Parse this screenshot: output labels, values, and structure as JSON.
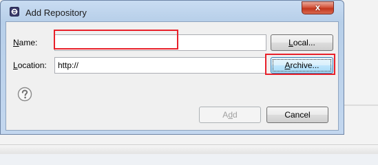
{
  "window": {
    "title": "Add Repository",
    "close_glyph": "x"
  },
  "form": {
    "name_label_hotkey": "N",
    "name_label_rest": "ame:",
    "name_value": "",
    "location_label_hotkey": "L",
    "location_label_rest": "ocation:",
    "location_value": "http://"
  },
  "buttons": {
    "local_label_hotkey": "L",
    "local_label_rest": "ocal...",
    "archive_label_hotkey": "A",
    "archive_label_rest": "rchive...",
    "add_label_pre": "A",
    "add_label_hotkey": "d",
    "add_label_post": "d",
    "cancel_label": "Cancel"
  },
  "icons": {
    "app": "eclipse-app-icon",
    "help": "help-question-icon",
    "close": "close-icon"
  },
  "colors": {
    "highlight": "#e8202a",
    "focus_button": "#3c7fb1"
  }
}
